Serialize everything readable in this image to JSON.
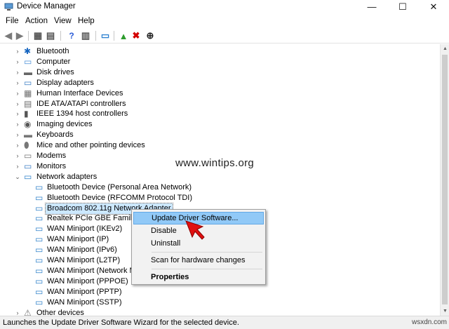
{
  "window": {
    "title": "Device Manager",
    "minimize": "—",
    "maximize": "☐",
    "close": "✕"
  },
  "menu": [
    "File",
    "Action",
    "View",
    "Help"
  ],
  "toolbar": [
    {
      "icon": "back-arrow-icon",
      "glyph": "◀",
      "color": "#7a7a7a"
    },
    {
      "icon": "forward-arrow-icon",
      "glyph": "▶",
      "color": "#7a7a7a"
    },
    {
      "icon": "show-hide-console-tree-icon",
      "glyph": "▦",
      "color": "#555555"
    },
    {
      "icon": "properties-icon",
      "glyph": "▤",
      "color": "#555555"
    },
    {
      "icon": "help-icon",
      "glyph": "?",
      "color": "#2a5bd7"
    },
    {
      "icon": "action-pane-icon",
      "glyph": "▥",
      "color": "#555555"
    },
    {
      "icon": "scan-hardware-icon",
      "glyph": "▭",
      "color": "#2a7fd0"
    },
    {
      "icon": "update-driver-icon",
      "glyph": "▲",
      "color": "#2e9c2e"
    },
    {
      "icon": "uninstall-device-icon",
      "glyph": "✖",
      "color": "#d40000"
    },
    {
      "icon": "disable-device-icon",
      "glyph": "⊕",
      "color": "#222222"
    }
  ],
  "colors": {
    "highlight": "#91c9f7",
    "selected_row": "#cce8ff",
    "cursor": "#e01010"
  },
  "tree": [
    {
      "label": "Bluetooth",
      "level": 1,
      "expander": "›",
      "icon": "bluetooth-icon",
      "glyph": "✱",
      "color": "#1565c0"
    },
    {
      "label": "Computer",
      "level": 1,
      "expander": "›",
      "icon": "computer-icon",
      "glyph": "▭",
      "color": "#4a90d9"
    },
    {
      "label": "Disk drives",
      "level": 1,
      "expander": "›",
      "icon": "disk-drive-icon",
      "glyph": "▬",
      "color": "#666666"
    },
    {
      "label": "Display adapters",
      "level": 1,
      "expander": "›",
      "icon": "display-adapter-icon",
      "glyph": "▭",
      "color": "#3b7dc4"
    },
    {
      "label": "Human Interface Devices",
      "level": 1,
      "expander": "›",
      "icon": "hid-icon",
      "glyph": "▦",
      "color": "#6e6e6e"
    },
    {
      "label": "IDE ATA/ATAPI controllers",
      "level": 1,
      "expander": "›",
      "icon": "ide-controller-icon",
      "glyph": "▤",
      "color": "#6e6e6e"
    },
    {
      "label": "IEEE 1394 host controllers",
      "level": 1,
      "expander": "›",
      "icon": "ieee1394-icon",
      "glyph": "▮",
      "color": "#555555"
    },
    {
      "label": "Imaging devices",
      "level": 1,
      "expander": "›",
      "icon": "camera-icon",
      "glyph": "◉",
      "color": "#555555"
    },
    {
      "label": "Keyboards",
      "level": 1,
      "expander": "›",
      "icon": "keyboard-icon",
      "glyph": "▬",
      "color": "#777777"
    },
    {
      "label": "Mice and other pointing devices",
      "level": 1,
      "expander": "›",
      "icon": "mouse-icon",
      "glyph": "⬮",
      "color": "#777777"
    },
    {
      "label": "Modems",
      "level": 1,
      "expander": "›",
      "icon": "modem-icon",
      "glyph": "▭",
      "color": "#777777"
    },
    {
      "label": "Monitors",
      "level": 1,
      "expander": "›",
      "icon": "monitor-icon",
      "glyph": "▭",
      "color": "#3b7dc4"
    },
    {
      "label": "Network adapters",
      "level": 1,
      "expander": "⌄",
      "icon": "network-adapter-icon",
      "glyph": "▭",
      "color": "#2c7fc9"
    },
    {
      "label": "Bluetooth Device (Personal Area Network)",
      "level": 2,
      "icon": "network-adapter-icon",
      "glyph": "▭",
      "color": "#2c7fc9"
    },
    {
      "label": "Bluetooth Device (RFCOMM Protocol TDI)",
      "level": 2,
      "icon": "network-adapter-icon",
      "glyph": "▭",
      "color": "#2c7fc9"
    },
    {
      "label": "Broadcom 802.11g Network Adapter",
      "level": 2,
      "icon": "network-adapter-icon",
      "glyph": "▭",
      "color": "#2c7fc9",
      "selected": true
    },
    {
      "label": "Realtek PCIe GBE Family Co",
      "level": 2,
      "icon": "network-adapter-icon",
      "glyph": "▭",
      "color": "#2c7fc9"
    },
    {
      "label": "WAN Miniport (IKEv2)",
      "level": 2,
      "icon": "network-adapter-icon",
      "glyph": "▭",
      "color": "#2c7fc9"
    },
    {
      "label": "WAN Miniport (IP)",
      "level": 2,
      "icon": "network-adapter-icon",
      "glyph": "▭",
      "color": "#2c7fc9"
    },
    {
      "label": "WAN Miniport (IPv6)",
      "level": 2,
      "icon": "network-adapter-icon",
      "glyph": "▭",
      "color": "#2c7fc9"
    },
    {
      "label": "WAN Miniport (L2TP)",
      "level": 2,
      "icon": "network-adapter-icon",
      "glyph": "▭",
      "color": "#2c7fc9"
    },
    {
      "label": "WAN Miniport (Network M",
      "level": 2,
      "icon": "network-adapter-icon",
      "glyph": "▭",
      "color": "#2c7fc9"
    },
    {
      "label": "WAN Miniport (PPPOE)",
      "level": 2,
      "icon": "network-adapter-icon",
      "glyph": "▭",
      "color": "#2c7fc9"
    },
    {
      "label": "WAN Miniport (PPTP)",
      "level": 2,
      "icon": "network-adapter-icon",
      "glyph": "▭",
      "color": "#2c7fc9"
    },
    {
      "label": "WAN Miniport (SSTP)",
      "level": 2,
      "icon": "network-adapter-icon",
      "glyph": "▭",
      "color": "#2c7fc9"
    },
    {
      "label": "Other devices",
      "level": 1,
      "expander": "›",
      "icon": "other-devices-icon",
      "glyph": "⚠",
      "color": "#777777"
    }
  ],
  "context_menu": {
    "update": "Update Driver Software...",
    "disable": "Disable",
    "uninstall": "Uninstall",
    "scan": "Scan for hardware changes",
    "properties": "Properties"
  },
  "watermark": "www.wintips.org",
  "corner_watermark": "wsxdn.com",
  "status": "Launches the Update Driver Software Wizard for the selected device."
}
